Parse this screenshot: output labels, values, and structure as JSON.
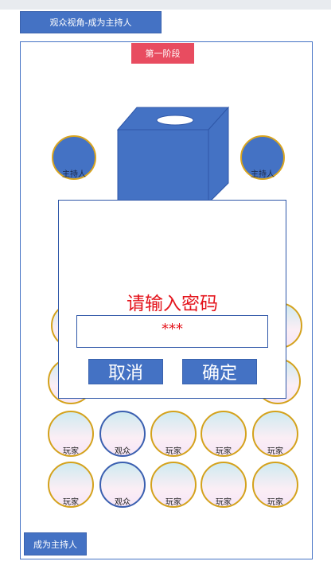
{
  "header": {
    "title": "观众视角-成为主持人"
  },
  "stage": {
    "label": "第一阶段"
  },
  "hosts": {
    "left_label": "主持人",
    "right_label": "主持人"
  },
  "dialog": {
    "title": "请输入密码",
    "password_value": "***",
    "cancel_label": "取消",
    "confirm_label": "确定"
  },
  "seats": {
    "row3": [
      "玩家",
      "观众",
      "玩家",
      "玩家",
      "玩家"
    ],
    "row4": [
      "玩家",
      "观众",
      "玩家",
      "玩家",
      "玩家"
    ]
  },
  "footer": {
    "become_host_label": "成为主持人"
  },
  "colors": {
    "accent": "#4472c4",
    "stage": "#e84c60",
    "alert_text": "#e4141c",
    "seat_border": "#d4a21c"
  }
}
